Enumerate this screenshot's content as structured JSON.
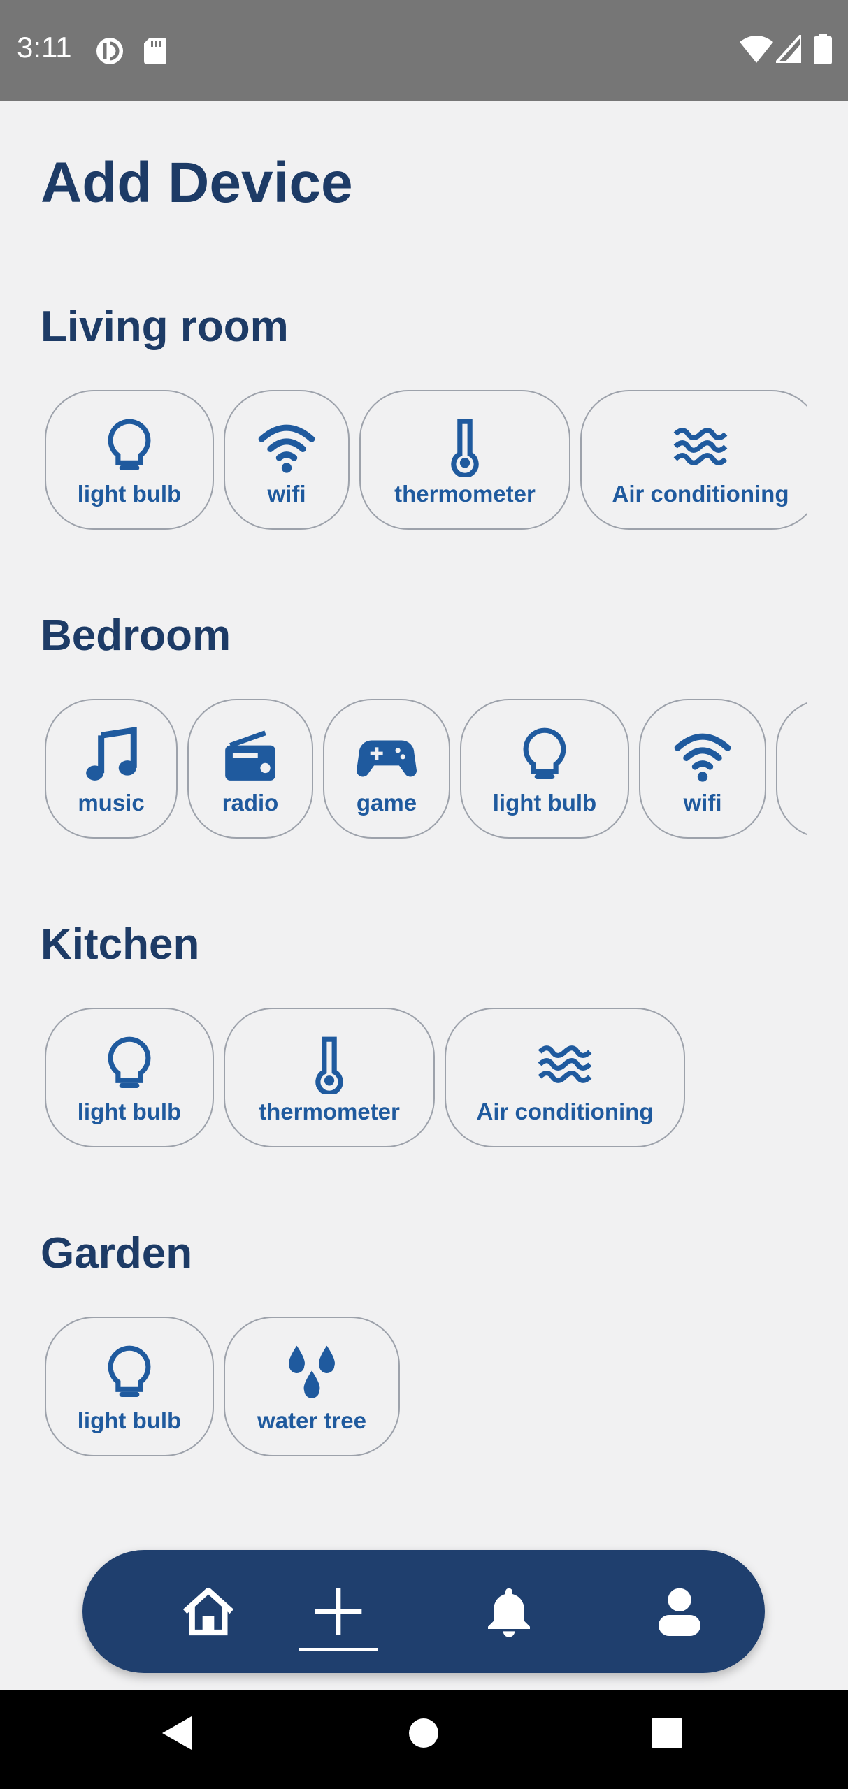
{
  "status": {
    "time": "3:11",
    "icons": [
      "sync-icon",
      "sd-card-icon",
      "wifi-signal-icon",
      "cell-signal-icon",
      "battery-icon"
    ]
  },
  "title": "Add Device",
  "colors": {
    "primary": "#1d3b66",
    "accent": "#1f5a9e",
    "nav": "#1f3f6e",
    "background": "#f1f1f2"
  },
  "rooms": [
    {
      "name": "Living room",
      "devices": [
        {
          "label": "light bulb",
          "icon": "lightbulb-icon"
        },
        {
          "label": "wifi",
          "icon": "wifi-icon"
        },
        {
          "label": "thermometer",
          "icon": "thermometer-icon"
        },
        {
          "label": "Air conditioning",
          "icon": "air-conditioning-icon"
        }
      ]
    },
    {
      "name": "Bedroom",
      "devices": [
        {
          "label": "music",
          "icon": "music-icon"
        },
        {
          "label": "radio",
          "icon": "radio-icon"
        },
        {
          "label": "game",
          "icon": "gamepad-icon"
        },
        {
          "label": "light bulb",
          "icon": "lightbulb-icon"
        },
        {
          "label": "wifi",
          "icon": "wifi-icon"
        }
      ]
    },
    {
      "name": "Kitchen",
      "devices": [
        {
          "label": "light bulb",
          "icon": "lightbulb-icon"
        },
        {
          "label": "thermometer",
          "icon": "thermometer-icon"
        },
        {
          "label": "Air conditioning",
          "icon": "air-conditioning-icon"
        }
      ]
    },
    {
      "name": "Garden",
      "devices": [
        {
          "label": "light bulb",
          "icon": "lightbulb-icon"
        },
        {
          "label": "water tree",
          "icon": "water-drops-icon"
        }
      ]
    }
  ],
  "nav": {
    "items": [
      "home-icon",
      "add-icon",
      "bell-icon",
      "profile-icon"
    ],
    "active": "add-icon"
  },
  "system_nav": [
    "back-icon",
    "home-circle-icon",
    "recents-icon"
  ]
}
